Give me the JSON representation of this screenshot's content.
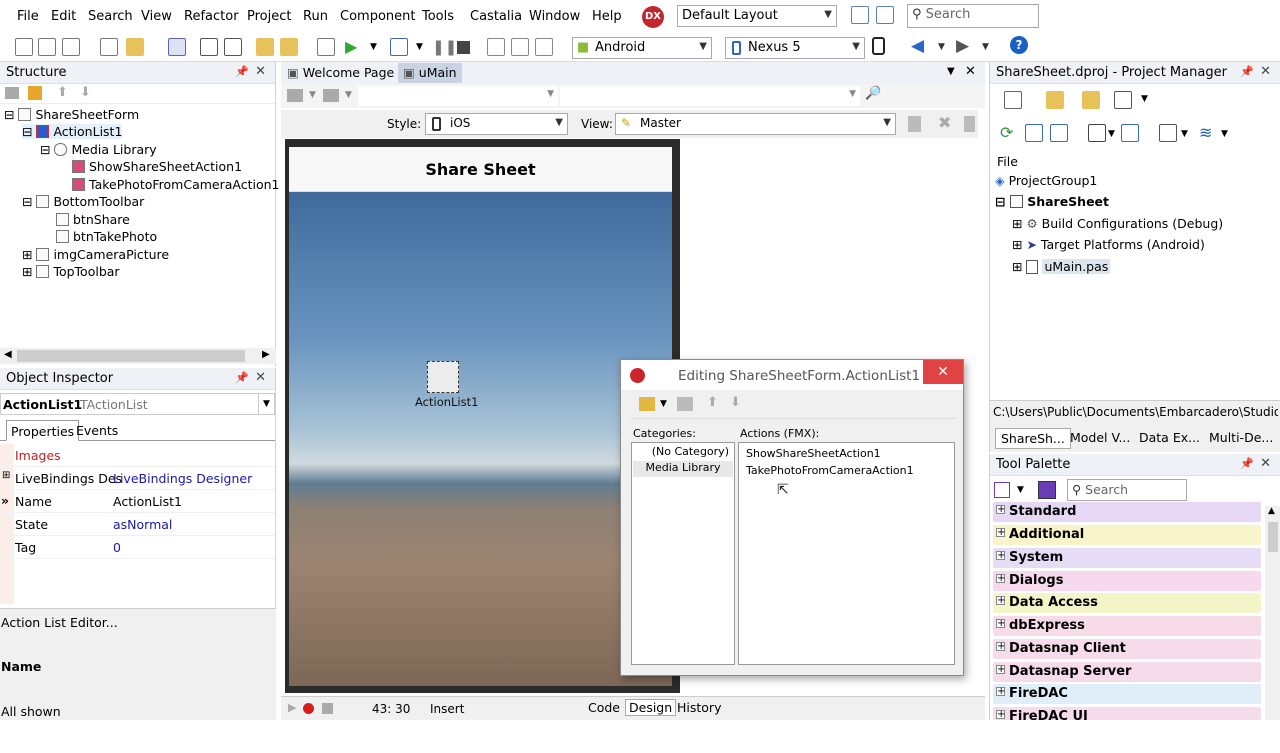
{
  "menu": [
    "File",
    "Edit",
    "Search",
    "View",
    "Refactor",
    "Project",
    "Run",
    "Component",
    "Tools",
    "Castalia",
    "Window",
    "Help"
  ],
  "menu_badge": "DX",
  "layout_combo": "Default Layout",
  "search_placeholder": "Search",
  "platform_combo": "Android",
  "device_combo": "Nexus 5",
  "structure": {
    "title": "Structure",
    "items": [
      "ShareSheetForm",
      "ActionList1",
      "Media Library",
      "ShowShareSheetAction1",
      "TakePhotoFromCameraAction1",
      "BottomToolbar",
      "btnShare",
      "btnTakePhoto",
      "imgCameraPicture",
      "TopToolbar"
    ]
  },
  "inspector": {
    "title": "Object Inspector",
    "object_name": "ActionList1",
    "object_type": "TActionList",
    "tab_properties": "Properties",
    "tab_events": "Events",
    "rows": [
      {
        "k": "Images",
        "v": ""
      },
      {
        "k": "LiveBindings Des",
        "v": "LiveBindings Designer"
      },
      {
        "k": "Name",
        "v": "ActionList1"
      },
      {
        "k": "State",
        "v": "asNormal"
      },
      {
        "k": "Tag",
        "v": "0"
      }
    ],
    "footer_link": "Action List Editor...",
    "footer_name": "Name",
    "status": "All shown"
  },
  "editor": {
    "tab_welcome": "Welcome Page",
    "tab_umain": "uMain",
    "style_label": "Style:",
    "style_value": "iOS",
    "view_label": "View:",
    "view_value": "Master",
    "form_title": "Share Sheet",
    "component_label": "ActionList1",
    "position": "43: 30",
    "mode": "Insert",
    "bottom_tabs": [
      "Code",
      "Design",
      "History"
    ]
  },
  "dialog": {
    "title": "Editing ShareSheetForm.ActionList1",
    "categories_label": "Categories:",
    "actions_label": "Actions (FMX):",
    "categories": [
      "(No Category)",
      "Media Library"
    ],
    "actions": [
      "ShowShareSheetAction1",
      "TakePhotoFromCameraAction1"
    ]
  },
  "project": {
    "title": "ShareSheet.dproj - Project Manager",
    "file_label": "File",
    "items": [
      "ProjectGroup1",
      "ShareSheet",
      "Build Configurations (Debug)",
      "Target Platforms (Android)",
      "uMain.pas"
    ],
    "path": "C:\\Users\\Public\\Documents\\Embarcadero\\Studio\\",
    "tabs": [
      "ShareSh...",
      "Model V...",
      "Data Ex...",
      "Multi-De..."
    ]
  },
  "palette": {
    "title": "Tool Palette",
    "search_placeholder": "Search",
    "categories": [
      {
        "name": "Standard",
        "color": "#e6d8f5"
      },
      {
        "name": "Additional",
        "color": "#f8f3c8"
      },
      {
        "name": "System",
        "color": "#e7dcf6"
      },
      {
        "name": "Dialogs",
        "color": "#f7d9ef"
      },
      {
        "name": "Data Access",
        "color": "#f3f5c9"
      },
      {
        "name": "dbExpress",
        "color": "#f7dce8"
      },
      {
        "name": "Datasnap Client",
        "color": "#f6dbea"
      },
      {
        "name": "Datasnap Server",
        "color": "#f6dbea"
      },
      {
        "name": "FireDAC",
        "color": "#dfeef8"
      },
      {
        "name": "FireDAC UI",
        "color": "#f6dbea"
      }
    ]
  }
}
